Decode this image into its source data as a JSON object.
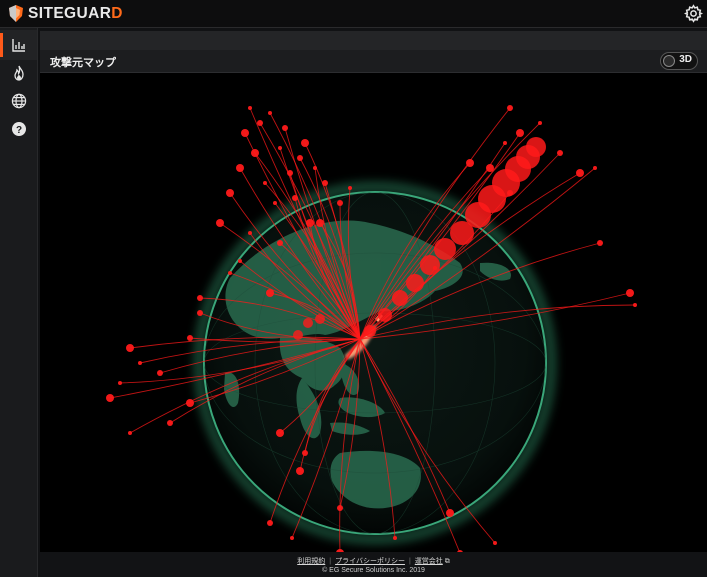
{
  "app": {
    "brand_main": "SITEGUAR",
    "brand_accent": "D",
    "brand_color": "#ff6a1a"
  },
  "sidebar": {
    "items": [
      {
        "icon": "bar-chart-icon",
        "active": true
      },
      {
        "icon": "flame-icon",
        "active": false
      },
      {
        "icon": "globe-icon",
        "active": false
      },
      {
        "icon": "help-icon",
        "active": false
      }
    ]
  },
  "panel": {
    "title": "攻撃元マップ",
    "toggle_label": "3D"
  },
  "map": {
    "attack_color": "#ff1a1a",
    "land_color": "#2a6b4f",
    "target_color": "#ff9a70"
  },
  "footer": {
    "link_terms": "利用規約",
    "link_privacy": "プライバシーポリシー",
    "link_company": "運営会社",
    "copyright": "© EG Secure Solutions Inc. 2019"
  }
}
